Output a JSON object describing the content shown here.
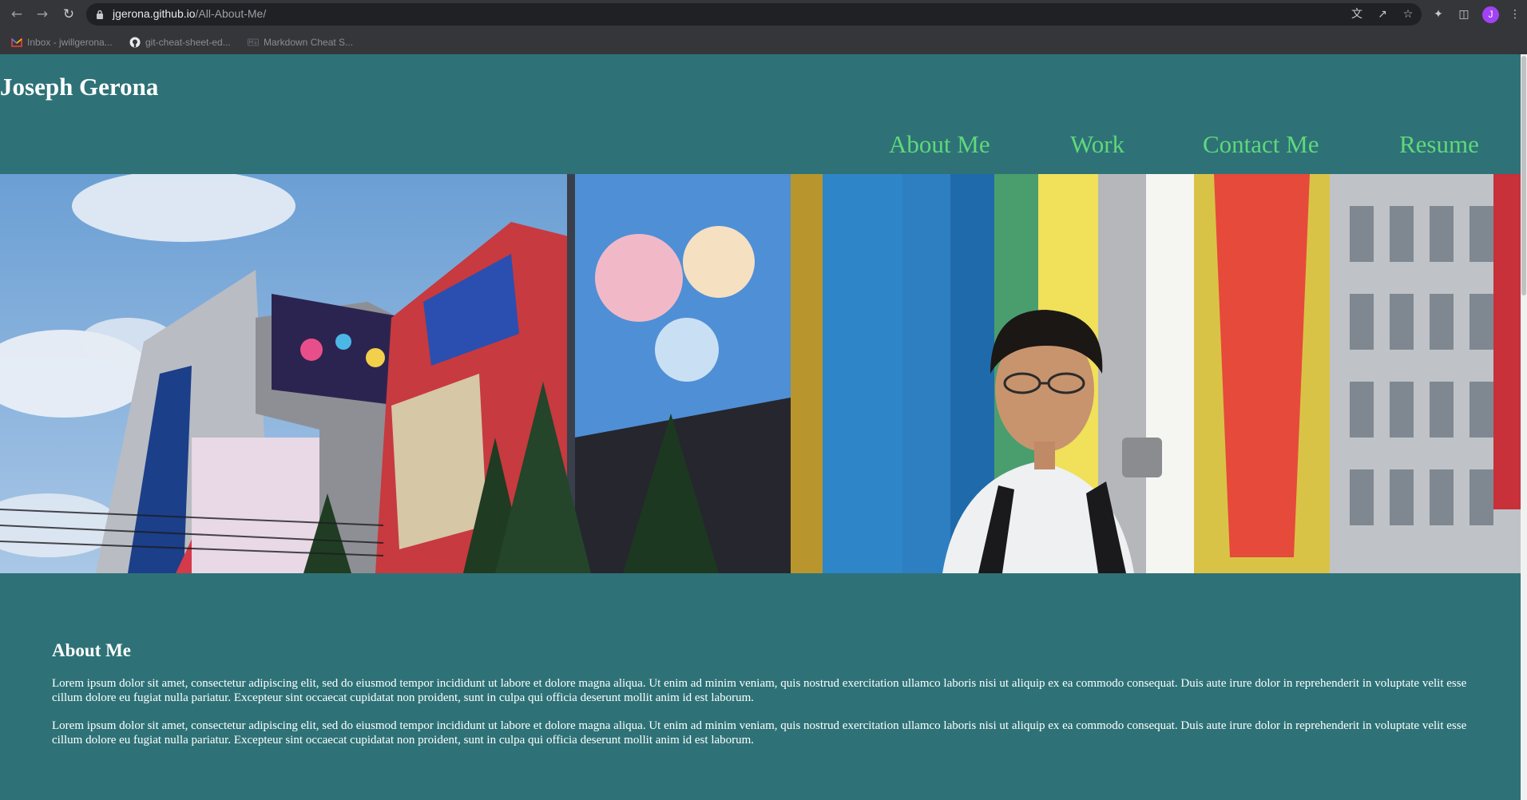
{
  "browser": {
    "url_host": "jgerona.github.io",
    "url_path": "/All-About-Me/",
    "avatar_letter": "J",
    "icons": {
      "back": "back-arrow-icon",
      "forward": "forward-arrow-icon",
      "reload": "reload-icon",
      "lock": "lock-icon",
      "translate": "translate-icon",
      "share": "share-icon",
      "bookmark": "star-icon",
      "extensions": "puzzle-icon",
      "side_panel": "side-panel-icon",
      "menu": "kebab-menu-icon"
    },
    "bookmarks": [
      {
        "label": "Inbox - jwillgerona...",
        "icon": "gmail-icon"
      },
      {
        "label": "git-cheat-sheet-ed...",
        "icon": "github-icon"
      },
      {
        "label": "Markdown Cheat S...",
        "icon": "markdown-icon"
      }
    ]
  },
  "site": {
    "title": "Joseph Gerona",
    "nav": [
      "About Me",
      "Work",
      "Contact Me",
      "Resume"
    ],
    "colors": {
      "background": "#2e7277",
      "nav_link": "#5fd87a",
      "text": "#ffffff"
    }
  },
  "about": {
    "heading": "About Me",
    "paragraphs": [
      "Lorem ipsum dolor sit amet, consectetur adipiscing elit, sed do eiusmod tempor incididunt ut labore et dolore magna aliqua. Ut enim ad minim veniam, quis nostrud exercitation ullamco laboris nisi ut aliquip ex ea commodo consequat. Duis aute irure dolor in reprehenderit in voluptate velit esse cillum dolore eu fugiat nulla pariatur. Excepteur sint occaecat cupidatat non proident, sunt in culpa qui officia deserunt mollit anim id est laborum.",
      "Lorem ipsum dolor sit amet, consectetur adipiscing elit, sed do eiusmod tempor incididunt ut labore et dolore magna aliqua. Ut enim ad minim veniam, quis nostrud exercitation ullamco laboris nisi ut aliquip ex ea commodo consequat. Duis aute irure dolor in reprehenderit in voluptate velit esse cillum dolore eu fugiat nulla pariatur. Excepteur sint occaecat cupidatat non proident, sunt in culpa qui officia deserunt mollit anim id est laborum."
    ]
  }
}
